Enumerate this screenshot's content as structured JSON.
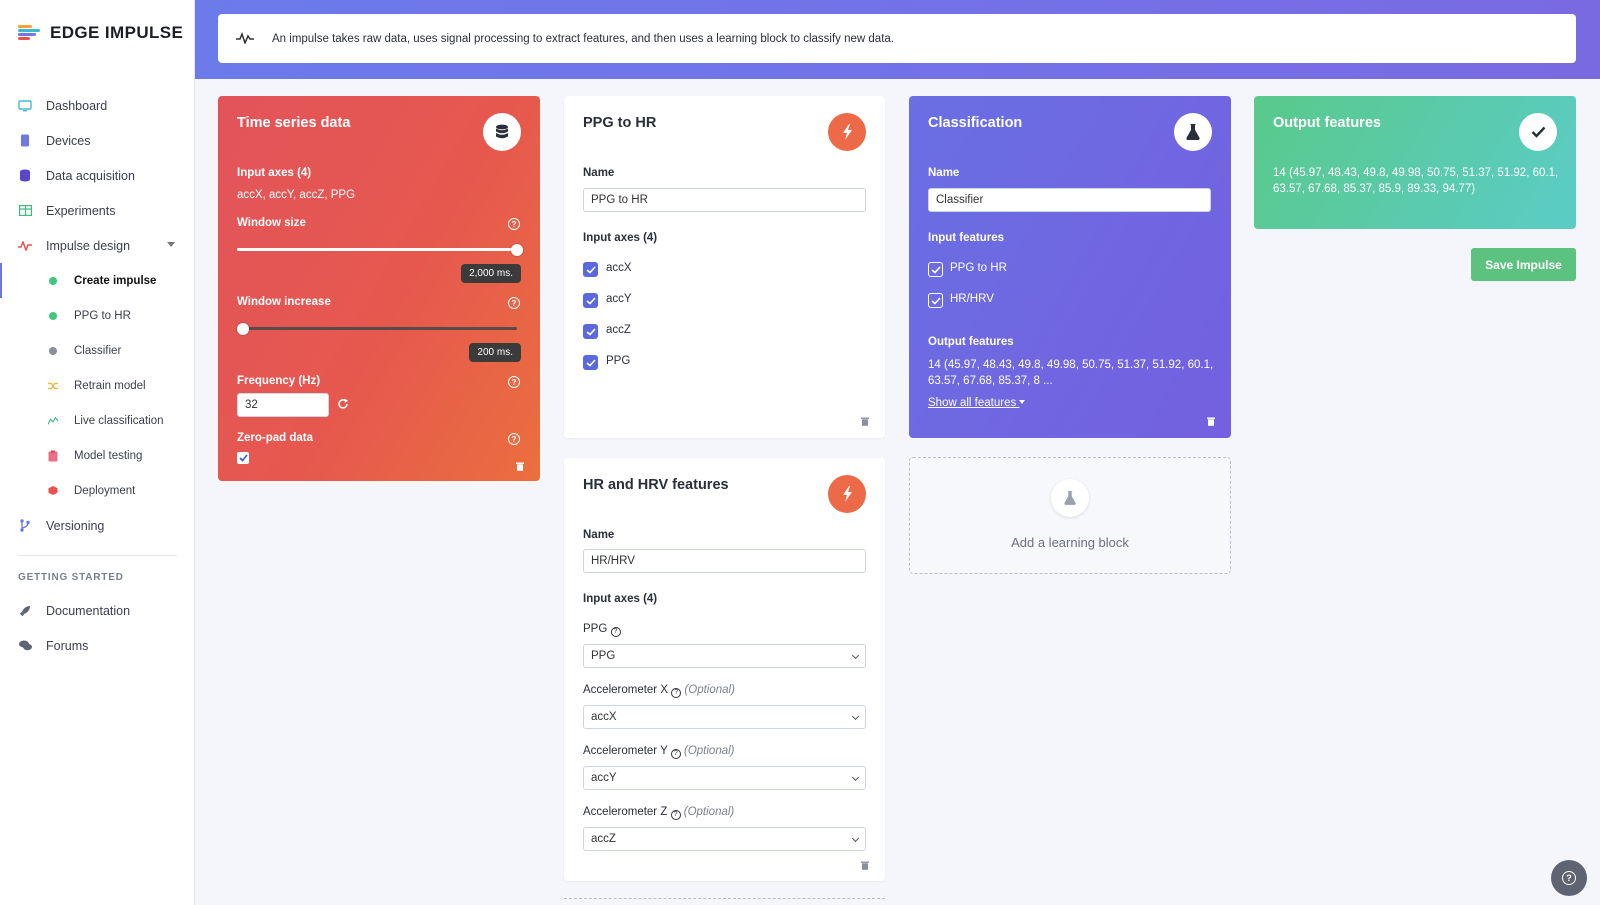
{
  "brand": {
    "name": "EDGE IMPULSE"
  },
  "sidebar": {
    "items": [
      {
        "label": "Dashboard",
        "icon": "monitor-icon"
      },
      {
        "label": "Devices",
        "icon": "device-icon"
      },
      {
        "label": "Data acquisition",
        "icon": "database-icon"
      },
      {
        "label": "Experiments",
        "icon": "table-icon"
      },
      {
        "label": "Impulse design",
        "icon": "pulse-icon"
      }
    ],
    "sub_items": [
      {
        "label": "Create impulse",
        "status_color": "#3fc77e"
      },
      {
        "label": "PPG to HR",
        "status_color": "#3fc77e"
      },
      {
        "label": "Classifier",
        "status_color": "#8a8f9c"
      },
      {
        "label": "Retrain model",
        "icon": "shuffle-icon"
      },
      {
        "label": "Live classification",
        "icon": "graph-icon"
      },
      {
        "label": "Model testing",
        "icon": "clipboard-icon"
      },
      {
        "label": "Deployment",
        "icon": "cube-icon"
      }
    ],
    "versioning_label": "Versioning",
    "section_heading": "GETTING STARTED",
    "help_items": [
      {
        "label": "Documentation",
        "icon": "rocket-icon"
      },
      {
        "label": "Forums",
        "icon": "chat-icon"
      }
    ]
  },
  "banner": {
    "text": "An impulse takes raw data, uses signal processing to extract features, and then uses a learning block to classify new data."
  },
  "time_series": {
    "title": "Time series data",
    "input_axes_label": "Input axes (4)",
    "input_axes_value": "accX, accY, accZ, PPG",
    "window_size_label": "Window size",
    "window_size_value": "2,000 ms.",
    "window_size_fraction": 1.0,
    "window_increase_label": "Window increase",
    "window_increase_value": "200 ms.",
    "window_increase_fraction": 0.02,
    "frequency_label": "Frequency (Hz)",
    "frequency_value": "32",
    "zero_pad_label": "Zero-pad data",
    "zero_pad_checked": true
  },
  "ppg_block": {
    "title": "PPG to HR",
    "name_label": "Name",
    "name_value": "PPG to HR",
    "input_axes_label": "Input axes (4)",
    "axes": [
      "accX",
      "accY",
      "accZ",
      "PPG"
    ]
  },
  "hrv_block": {
    "title": "HR and HRV features",
    "name_label": "Name",
    "name_value": "HR/HRV",
    "input_axes_label": "Input axes (4)",
    "ppg_label": "PPG",
    "ppg_value": "PPG",
    "accx_label": "Accelerometer X",
    "accx_value": "accX",
    "accy_label": "Accelerometer Y",
    "accy_value": "accY",
    "accz_label": "Accelerometer Z",
    "accz_value": "accZ",
    "optional_text": "(Optional)"
  },
  "classification": {
    "title": "Classification",
    "name_label": "Name",
    "name_value": "Classifier",
    "input_features_label": "Input features",
    "features": [
      "PPG to HR",
      "HR/HRV"
    ],
    "output_features_label": "Output features",
    "output_features_value": "14 (45.97, 48.43, 49.8, 49.98, 50.75, 51.37, 51.92, 60.1, 63.57, 67.68, 85.37, 8 ...",
    "show_all_label": "Show all features"
  },
  "output": {
    "title": "Output features",
    "value": "14 (45.97, 48.43, 49.8, 49.98, 50.75, 51.37, 51.92, 60.1, 63.57, 67.68, 85.37, 85.9, 89.33, 94.77)"
  },
  "save_button": "Save Impulse",
  "add_learning_block": "Add a learning block",
  "colors": {
    "accent": "#6b78e0",
    "red_card": "#e6584e",
    "purple_card": "#7066e2",
    "green_card": "#5acba8",
    "dsp_icon": "#ec6a47",
    "save": "#5cc27f"
  }
}
